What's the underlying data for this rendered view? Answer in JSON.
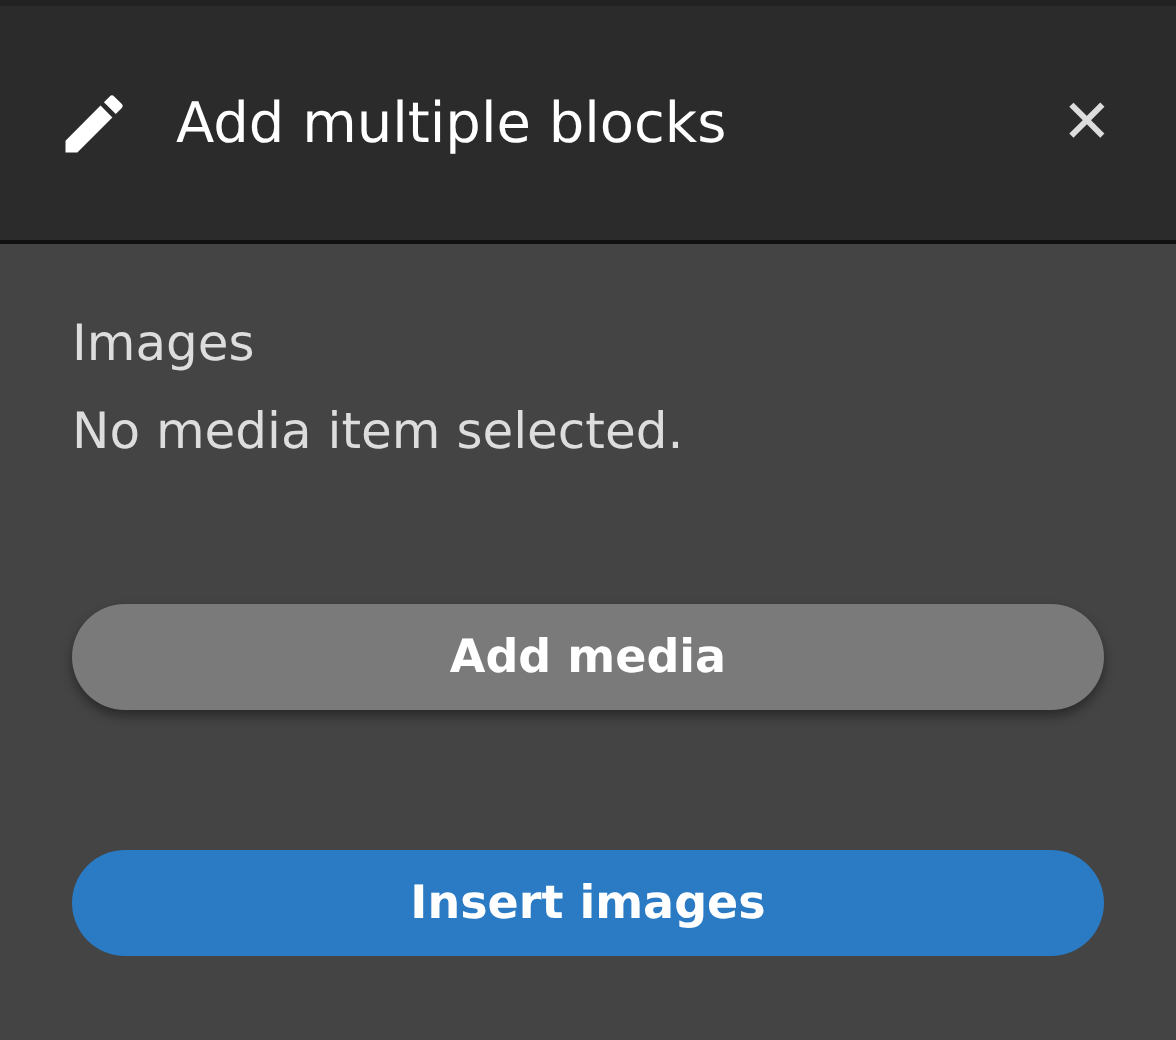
{
  "dialog": {
    "title": "Add multiple blocks",
    "close": "✕"
  },
  "field": {
    "label": "Images",
    "value": "No media item selected."
  },
  "buttons": [
    {
      "label": "Add media",
      "kind": "secondary"
    },
    {
      "label": "Insert images",
      "kind": "primary"
    }
  ]
}
